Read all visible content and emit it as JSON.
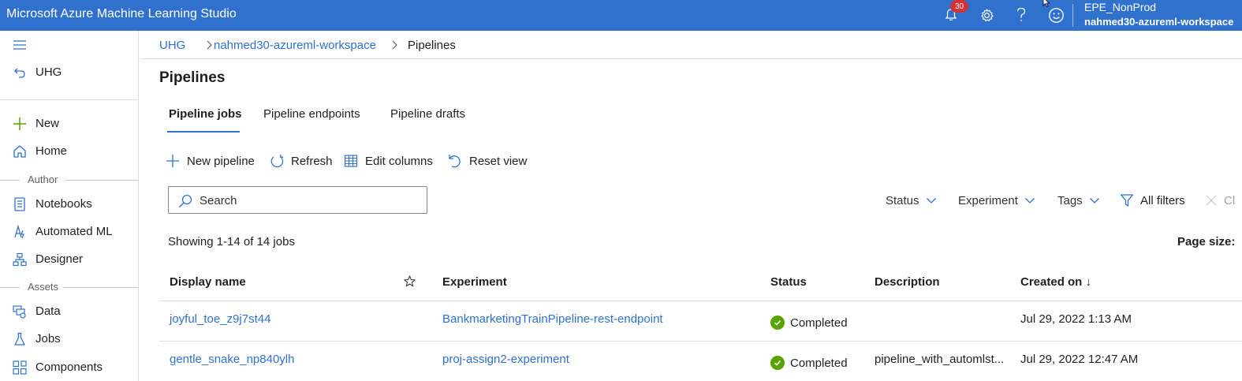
{
  "app": {
    "title": "Microsoft Azure Machine Learning Studio",
    "notification_count": "30",
    "tenant": "EPE_NonProd",
    "workspace": "nahmed30-azureml-workspace"
  },
  "sidebar": {
    "back_label": "UHG",
    "items_top": [
      {
        "label": "New",
        "icon": "plus-icon"
      },
      {
        "label": "Home",
        "icon": "home-icon"
      }
    ],
    "author_group": "Author",
    "author_items": [
      {
        "label": "Notebooks",
        "icon": "notebook-icon"
      },
      {
        "label": "Automated ML",
        "icon": "automated-ml-icon"
      },
      {
        "label": "Designer",
        "icon": "designer-icon"
      }
    ],
    "assets_group": "Assets",
    "assets_items": [
      {
        "label": "Data",
        "icon": "data-icon"
      },
      {
        "label": "Jobs",
        "icon": "flask-icon"
      },
      {
        "label": "Components",
        "icon": "components-icon"
      }
    ]
  },
  "breadcrumb": [
    "UHG",
    "nahmed30-azureml-workspace",
    "Pipelines"
  ],
  "page": {
    "title": "Pipelines",
    "tabs": [
      "Pipeline jobs",
      "Pipeline endpoints",
      "Pipeline drafts"
    ],
    "active_tab": "Pipeline jobs"
  },
  "toolbar": {
    "new_pipeline": "New pipeline",
    "refresh": "Refresh",
    "edit_columns": "Edit columns",
    "reset_view": "Reset view"
  },
  "search": {
    "placeholder": "Search",
    "value": ""
  },
  "filters": {
    "status": "Status",
    "experiment": "Experiment",
    "tags": "Tags",
    "all_filters": "All filters",
    "clear": "Cl"
  },
  "summary": {
    "showing": "Showing 1-14 of 14 jobs",
    "page_size": "Page size:"
  },
  "table": {
    "columns": {
      "display_name": "Display name",
      "experiment": "Experiment",
      "status": "Status",
      "description": "Description",
      "created_on": "Created on ↓"
    },
    "rows": [
      {
        "display_name": "joyful_toe_z9j7st44",
        "experiment": "BankmarketingTrainPipeline-rest-endpoint",
        "status": "Completed",
        "description": "",
        "created_on": "Jul 29, 2022 1:13 AM"
      },
      {
        "display_name": "gentle_snake_np840ylh",
        "experiment": "proj-assign2-experiment",
        "status": "Completed",
        "description": "pipeline_with_automlst...",
        "created_on": "Jul 29, 2022 12:47 AM"
      }
    ]
  },
  "colors": {
    "topbar": "#2f71cc",
    "link": "#2f71cc",
    "success": "#57a300",
    "badge": "#d13438"
  }
}
